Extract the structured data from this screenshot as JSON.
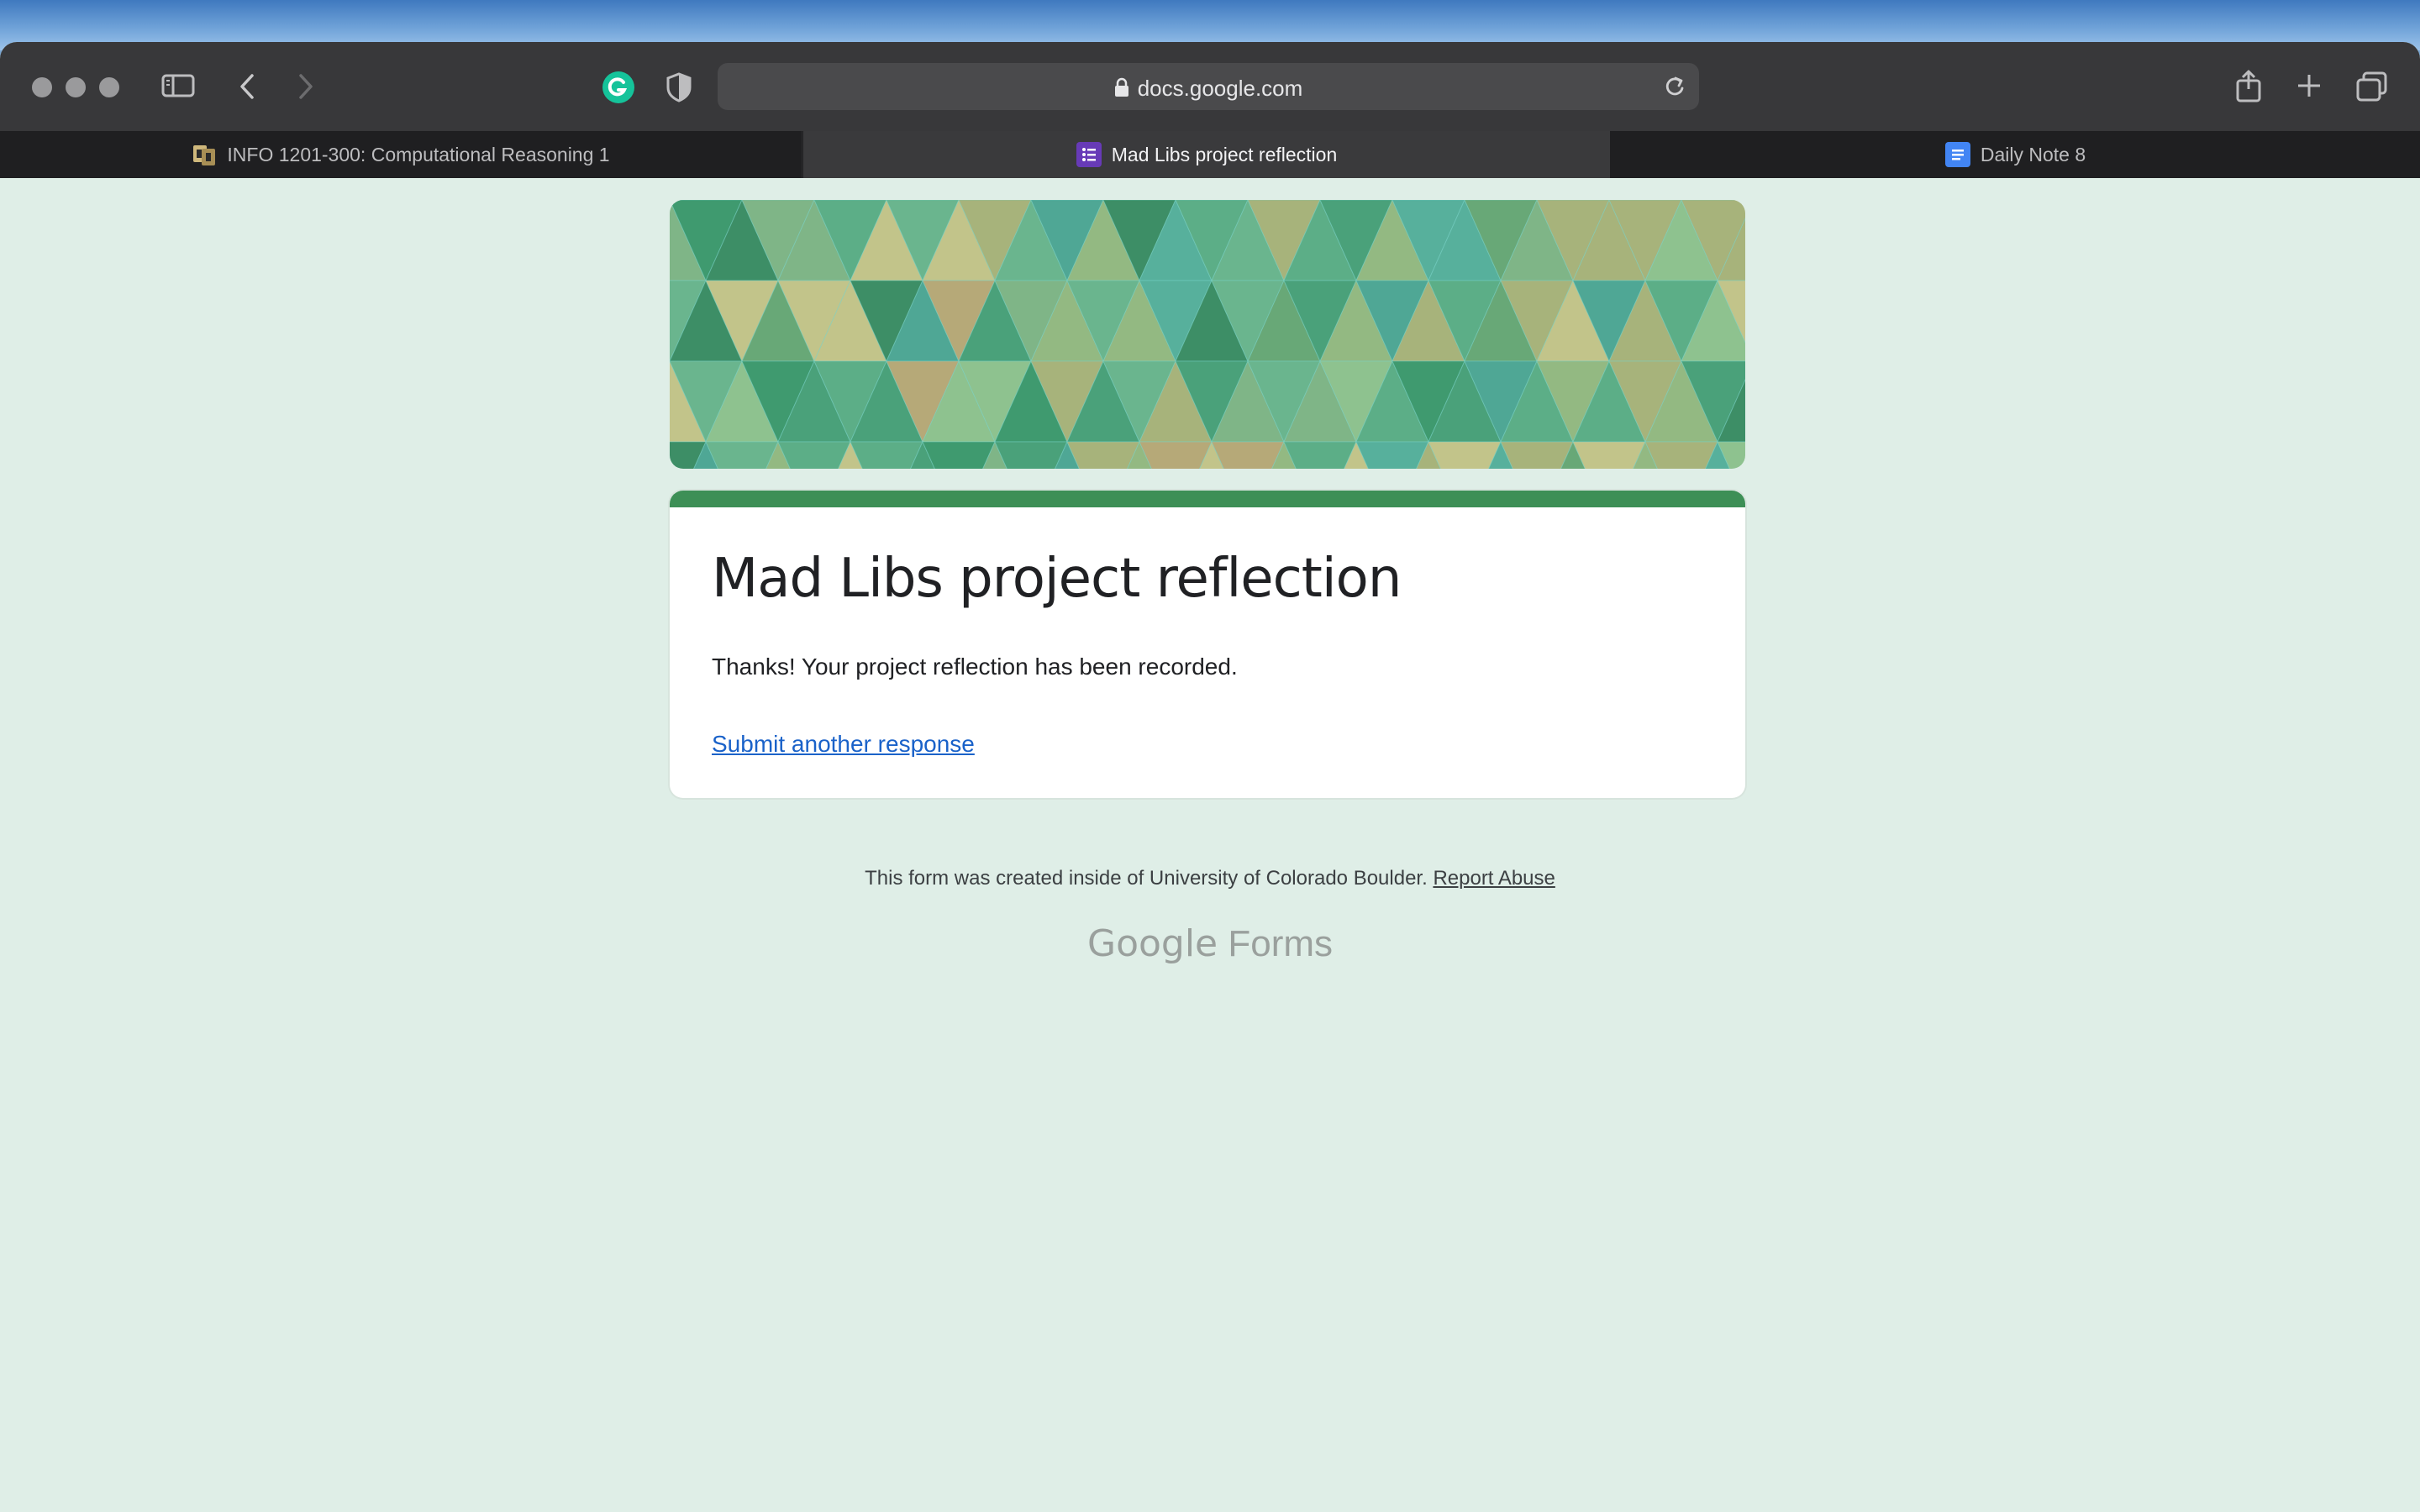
{
  "browser": {
    "url": "docs.google.com",
    "tabs": [
      {
        "label": "INFO 1201-300: Computational Reasoning 1",
        "active": false,
        "favicon": "cu-boulder-icon"
      },
      {
        "label": "Mad Libs project reflection",
        "active": true,
        "favicon": "google-forms-icon"
      },
      {
        "label": "Daily Note 8",
        "active": false,
        "favicon": "google-docs-icon"
      }
    ]
  },
  "form": {
    "title": "Mad Libs project reflection",
    "confirmation": "Thanks! Your project reflection has been recorded.",
    "submit_another": "Submit another response",
    "theme_color": "#3d8f56"
  },
  "footer": {
    "notice": "This form was created inside of University of Colorado Boulder.",
    "report_abuse": "Report Abuse",
    "brand_google": "Google",
    "brand_product": "Forms"
  }
}
